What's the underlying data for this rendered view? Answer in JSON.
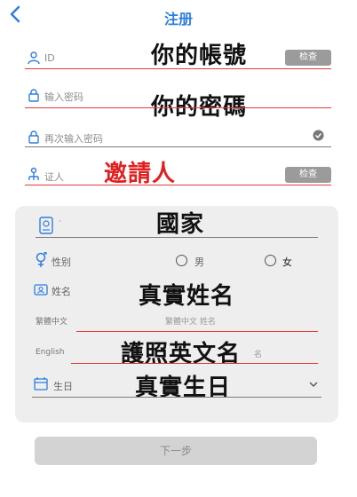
{
  "header": {
    "title": "注册"
  },
  "fields": {
    "id": {
      "placeholder": "ID",
      "check_label": "检查",
      "overlay": "你的帳號"
    },
    "password": {
      "placeholder": "输入密码",
      "overlay": "你的密碼"
    },
    "confirm": {
      "placeholder": "再次输入密码"
    },
    "referrer": {
      "placeholder": "证人",
      "check_label": "检查",
      "overlay": "邀請人"
    }
  },
  "card": {
    "country": {
      "value": "·",
      "overlay": "國家"
    },
    "gender": {
      "label": "性别",
      "male": "男",
      "female": "女"
    },
    "name": {
      "label": "姓名",
      "overlay": "真實姓名",
      "trad_label": "繁體中文",
      "trad_placeholder": "繁體中文 姓名"
    },
    "english": {
      "label": "English",
      "overlay": "護照英文名",
      "suffix": "名"
    },
    "birthday": {
      "label": "生日",
      "overlay": "真實生日"
    }
  },
  "footer": {
    "next_label": "下一步"
  },
  "colors": {
    "accent": "#2f7ee0",
    "underline_red": "#e23b3b",
    "button_grey": "#9b9b9b"
  }
}
